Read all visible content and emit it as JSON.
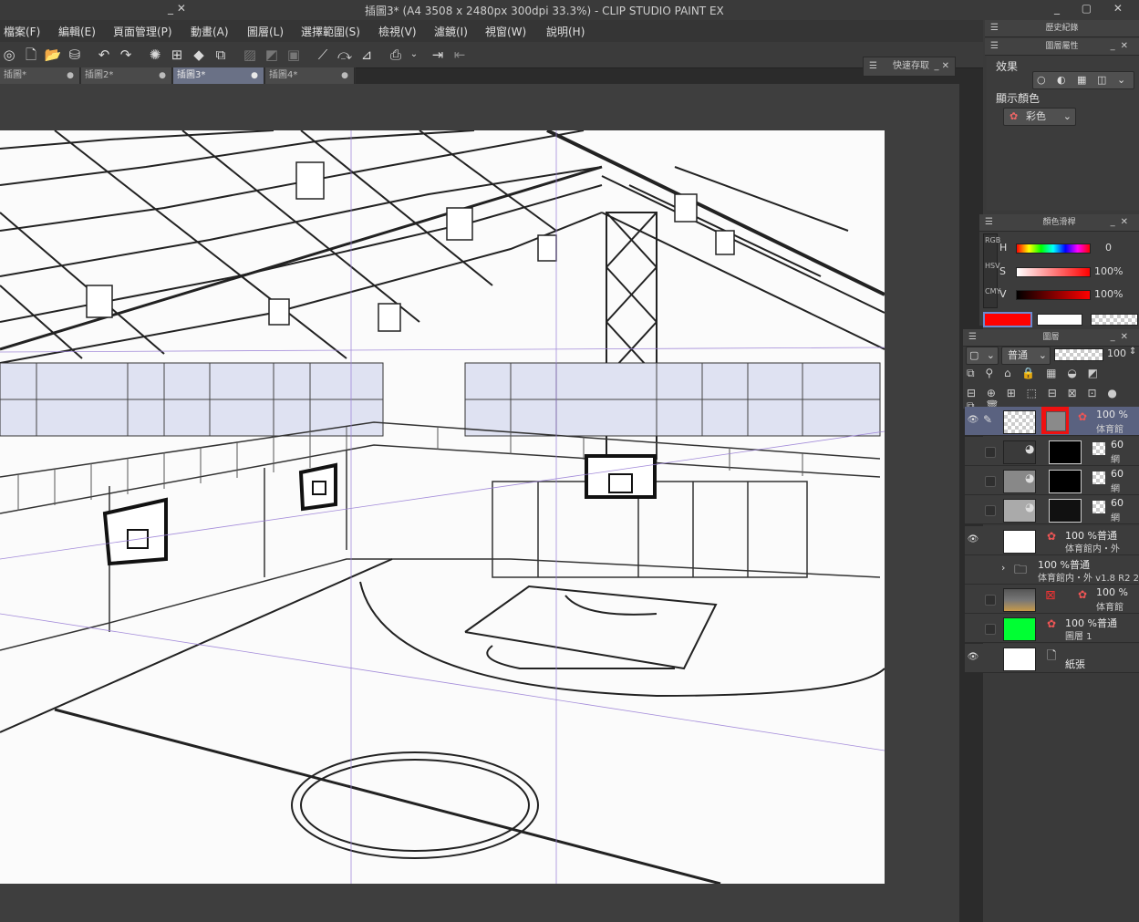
{
  "window": {
    "title": "插圖3* (A4 3508 x 2480px 300dpi 33.3%)  - CLIP STUDIO PAINT EX"
  },
  "menu": [
    "檔案(F)",
    "編輯(E)",
    "頁面管理(P)",
    "動畫(A)",
    "圖層(L)",
    "選擇範圍(S)",
    "檢視(V)",
    "濾鏡(I)",
    "視窗(W)",
    "說明(H)"
  ],
  "tabs": [
    {
      "label": "插圖*",
      "active": false
    },
    {
      "label": "插圖2*",
      "active": false
    },
    {
      "label": "插圖3*",
      "active": true
    },
    {
      "label": "插圖4*",
      "active": false
    }
  ],
  "quick_save": {
    "label": "快速存取"
  },
  "history_panel": {
    "title": "歷史紀錄"
  },
  "layer_property": {
    "title": "圖層屬性",
    "effect_label": "效果",
    "display_color_label": "顯示顏色",
    "display_color_value": "彩色"
  },
  "color_slider": {
    "title": "顏色滑桿",
    "tabs": [
      "RGB",
      "HSV",
      "CMY"
    ],
    "h_label": "H",
    "h_value": "0",
    "s_label": "S",
    "s_value": "100%",
    "v_label": "V",
    "v_value": "100%",
    "main_color": "#ff0000",
    "sub_color": "#ffffff"
  },
  "layer_panel": {
    "title": "圖層",
    "blend_mode": "普通",
    "opacity": "100",
    "layers": [
      {
        "opacity": "100 %",
        "name": "体育館",
        "selected": true,
        "thumb": "checker",
        "visible": true
      },
      {
        "opacity": "60",
        "name": "網",
        "selected": false,
        "thumb": "black-white",
        "visible": false
      },
      {
        "opacity": "60",
        "name": "網",
        "selected": false,
        "thumb": "black-white",
        "visible": false
      },
      {
        "opacity": "60",
        "name": "網",
        "selected": false,
        "thumb": "black-white",
        "visible": false
      },
      {
        "opacity": "100 %普通",
        "name": "体育館内・外",
        "selected": false,
        "thumb": "white",
        "visible": true
      },
      {
        "opacity": "100 %普通",
        "name": "体育館内・外 v1.8 R2 2",
        "selected": false,
        "thumb": "folder",
        "visible": false
      },
      {
        "opacity": "100 %",
        "name": "体育館",
        "selected": false,
        "thumb": "photo",
        "visible": false
      },
      {
        "opacity": "100 %普通",
        "name": "圖層 1",
        "selected": false,
        "thumb": "green",
        "visible": false
      },
      {
        "opacity": "",
        "name": "紙張",
        "selected": false,
        "thumb": "white",
        "visible": true
      }
    ]
  }
}
